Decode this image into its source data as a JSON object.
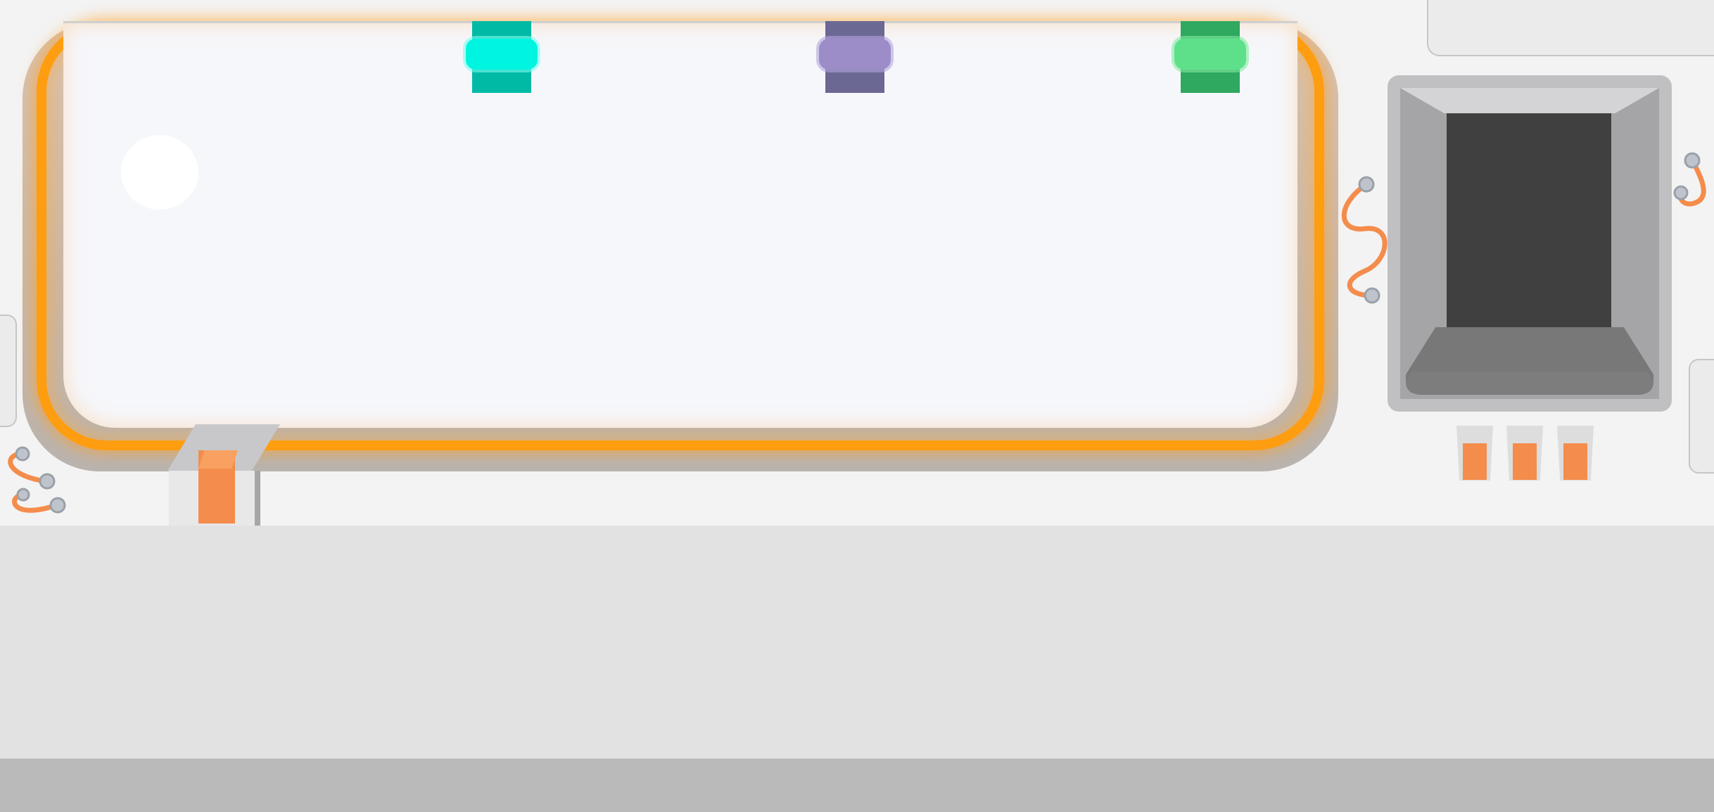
{
  "scene": "sorting-machine",
  "colors": {
    "background": "#f3f3f3",
    "floor": "#e2e2e2",
    "floor_edge": "#bababa",
    "screen_glow": "#ff9d10",
    "screen_surface": "#f6f7fb",
    "accent_orange": "#f48c4c",
    "hatch_dark": "#404040"
  },
  "clamps": [
    {
      "color_name": "teal",
      "post": "#00baa6",
      "pad": "#00f5e0"
    },
    {
      "color_name": "purple",
      "post": "#6c6894",
      "pad": "#9c8cc8"
    },
    {
      "color_name": "green",
      "post": "#2fa860",
      "pad": "#5ee08a"
    }
  ],
  "hatch_switches": [
    {
      "state": "on"
    },
    {
      "state": "on"
    },
    {
      "state": "on"
    }
  ],
  "icons": {
    "moon": "moon-icon",
    "cable": "cable-icon",
    "screw": "screw-icon"
  }
}
